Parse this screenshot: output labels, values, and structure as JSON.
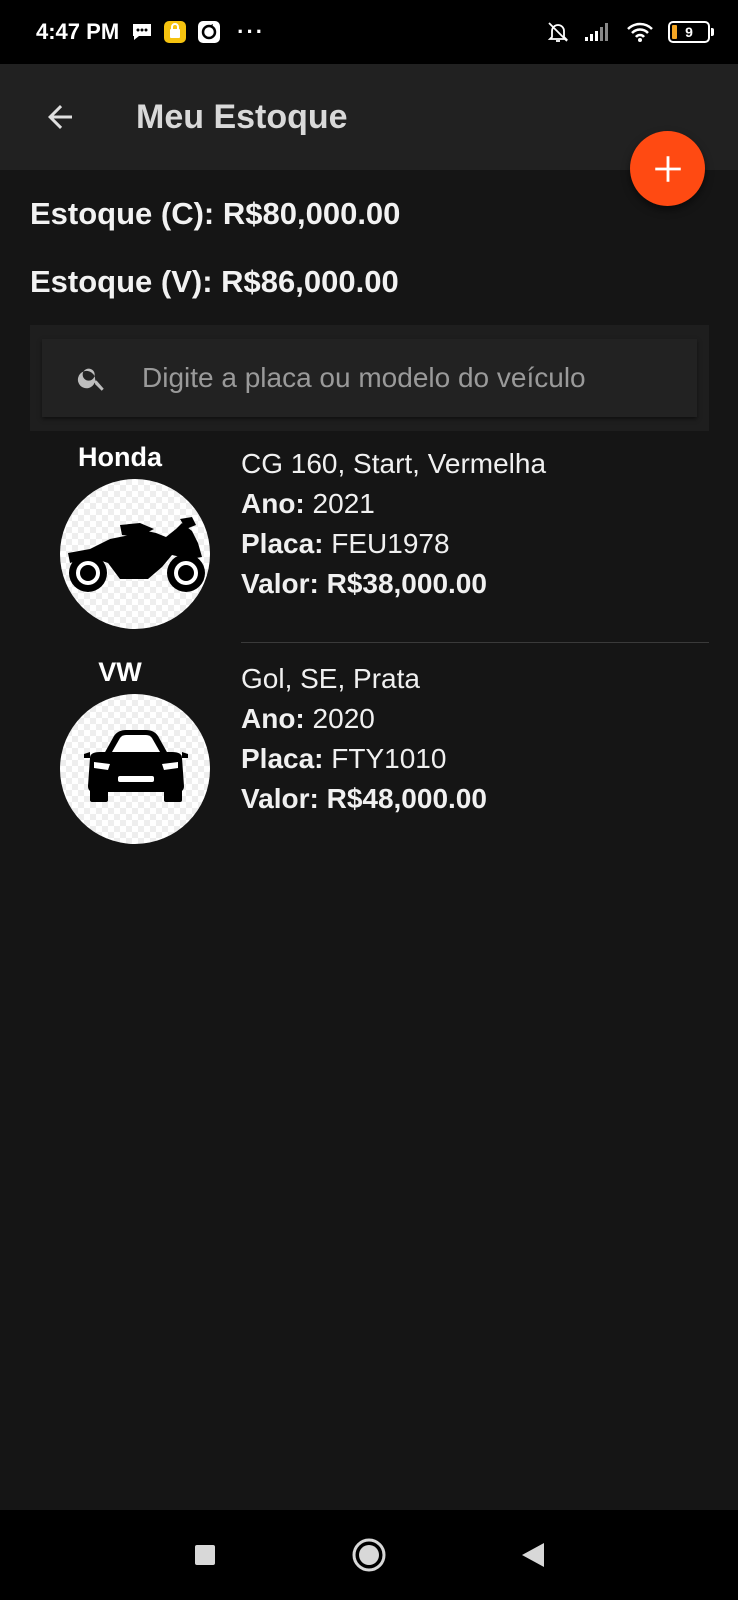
{
  "status_bar": {
    "time": "4:47 PM",
    "battery_level": "9",
    "icons": [
      "message-icon",
      "app-notification-icon",
      "sync-app-icon",
      "more-dots-icon",
      "notifications-off-icon",
      "signal-icon",
      "wifi-icon",
      "battery-icon"
    ],
    "dots": "···"
  },
  "app_bar": {
    "title": "Meu Estoque",
    "back_icon": "arrow-back-icon",
    "add_icon": "plus-icon"
  },
  "summary": {
    "cost_stock": "Estoque (C): R$80,000.00",
    "sale_stock": "Estoque (V): R$86,000.00"
  },
  "search": {
    "placeholder": "Digite a placa ou modelo do veículo",
    "value": ""
  },
  "vehicles": [
    {
      "brand": "Honda",
      "icon": "motorcycle-icon",
      "description": "CG 160, Start, Vermelha",
      "year_label": "Ano:",
      "year": "2021",
      "plate_label": "Placa:",
      "plate": "FEU1978",
      "value_label": "Valor:",
      "value": "R$38,000.00"
    },
    {
      "brand": "VW",
      "icon": "car-icon",
      "description": "Gol, SE, Prata",
      "year_label": "Ano:",
      "year": "2020",
      "plate_label": "Placa:",
      "plate": "FTY1010",
      "value_label": "Valor:",
      "value": "R$48,000.00"
    }
  ],
  "nav_bar": {
    "icons": [
      "recents-square-icon",
      "home-circle-icon",
      "back-triangle-icon"
    ]
  },
  "colors": {
    "background": "#151515",
    "app_bar": "#212121",
    "accent_fab": "#ff4a12",
    "battery_fill": "#f5a623"
  }
}
